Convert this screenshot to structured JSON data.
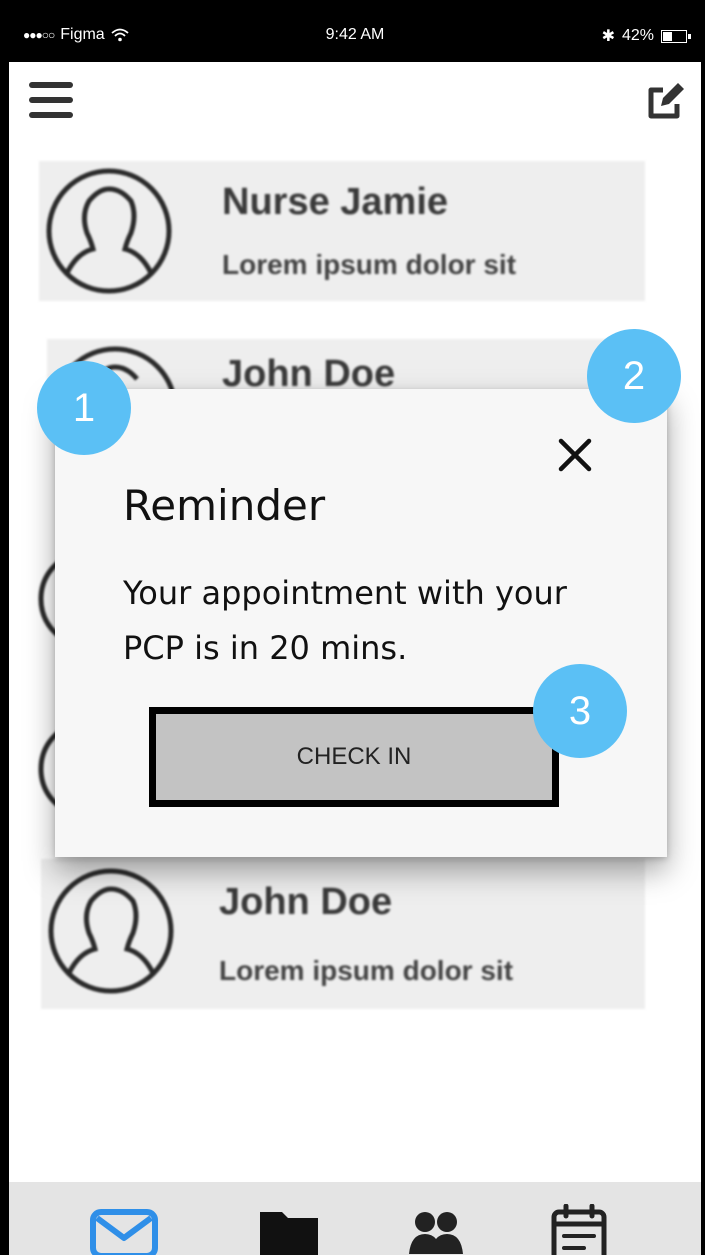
{
  "status_bar": {
    "carrier": "Figma",
    "time": "9:42 AM",
    "battery_percent": "42%",
    "battery_level": 0.42
  },
  "header": {
    "menu_icon": "hamburger-icon",
    "compose_icon": "compose-icon"
  },
  "contacts": [
    {
      "name": "Nurse Jamie",
      "subtitle": "Lorem ipsum dolor sit"
    },
    {
      "name": "John Doe",
      "subtitle": ""
    },
    {
      "name": "John Doe",
      "subtitle": "Lorem ipsum dolor sit"
    }
  ],
  "modal": {
    "title": "Reminder",
    "message": "Your appointment with your PCP is in 20 mins.",
    "button_label": "CHECK IN"
  },
  "badges": [
    "1",
    "2",
    "3"
  ],
  "tabs": [
    {
      "icon": "mail-icon",
      "active": true
    },
    {
      "icon": "folder-icon",
      "active": false
    },
    {
      "icon": "people-icon",
      "active": false
    },
    {
      "icon": "calendar-icon",
      "active": false
    }
  ],
  "colors": {
    "accent": "#2f8fe8",
    "badge": "#5bc0f5",
    "button_bg": "#c3c3c3"
  }
}
